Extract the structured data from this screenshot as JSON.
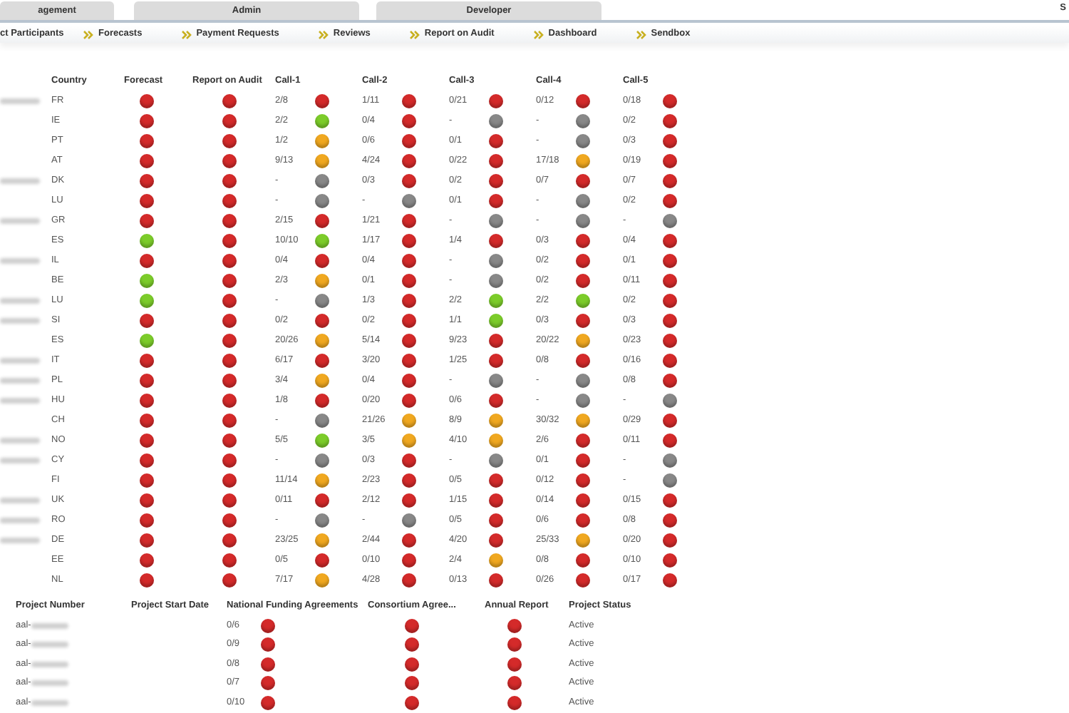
{
  "top_tabs": [
    {
      "label": "agement",
      "selected": false
    },
    {
      "label": "Admin",
      "selected": false
    },
    {
      "label": "Developer",
      "selected": false
    }
  ],
  "top_right": "S",
  "nav": [
    "ct Participants",
    "Forecasts",
    "Payment Requests",
    "Reviews",
    "Report on Audit",
    "Dashboard",
    "Sendbox"
  ],
  "calls_table": {
    "columns": [
      "Country",
      "Forecast",
      "Report on Audit",
      "Call-1",
      "Call-2",
      "Call-3",
      "Call-4",
      "Call-5"
    ],
    "rows": [
      {
        "redacted": true,
        "country": "FR",
        "forecast": {
          "color": "#d42a2a"
        },
        "report": {
          "color": "#d42a2a"
        },
        "calls": [
          {
            "value": "2/8",
            "color": "#d42a2a"
          },
          {
            "value": "1/11",
            "color": "#d42a2a"
          },
          {
            "value": "0/21",
            "color": "#d42a2a"
          },
          {
            "value": "0/12",
            "color": "#d42a2a"
          },
          {
            "value": "0/18",
            "color": "#d42a2a"
          }
        ]
      },
      {
        "redacted": false,
        "country": "IE",
        "forecast": {
          "color": "#d42a2a"
        },
        "report": {
          "color": "#d42a2a"
        },
        "calls": [
          {
            "value": "2/2",
            "color": "#7ccc2a"
          },
          {
            "value": "0/4",
            "color": "#d42a2a"
          },
          {
            "value": "-",
            "color": "#888888"
          },
          {
            "value": "-",
            "color": "#888888"
          },
          {
            "value": "0/2",
            "color": "#d42a2a"
          }
        ]
      },
      {
        "redacted": false,
        "country": "PT",
        "forecast": {
          "color": "#d42a2a"
        },
        "report": {
          "color": "#d42a2a"
        },
        "calls": [
          {
            "value": "1/2",
            "color": "#f0a820"
          },
          {
            "value": "0/6",
            "color": "#d42a2a"
          },
          {
            "value": "0/1",
            "color": "#d42a2a"
          },
          {
            "value": "-",
            "color": "#888888"
          },
          {
            "value": "0/3",
            "color": "#d42a2a"
          }
        ]
      },
      {
        "redacted": false,
        "country": "AT",
        "forecast": {
          "color": "#d42a2a"
        },
        "report": {
          "color": "#d42a2a"
        },
        "calls": [
          {
            "value": "9/13",
            "color": "#f0a820"
          },
          {
            "value": "4/24",
            "color": "#d42a2a"
          },
          {
            "value": "0/22",
            "color": "#d42a2a"
          },
          {
            "value": "17/18",
            "color": "#f0a820"
          },
          {
            "value": "0/19",
            "color": "#d42a2a"
          }
        ]
      },
      {
        "redacted": true,
        "country": "DK",
        "forecast": {
          "color": "#d42a2a"
        },
        "report": {
          "color": "#d42a2a"
        },
        "calls": [
          {
            "value": "-",
            "color": "#888888"
          },
          {
            "value": "0/3",
            "color": "#d42a2a"
          },
          {
            "value": "0/2",
            "color": "#d42a2a"
          },
          {
            "value": "0/7",
            "color": "#d42a2a"
          },
          {
            "value": "0/7",
            "color": "#d42a2a"
          }
        ]
      },
      {
        "redacted": false,
        "country": "LU",
        "forecast": {
          "color": "#d42a2a"
        },
        "report": {
          "color": "#d42a2a"
        },
        "calls": [
          {
            "value": "-",
            "color": "#888888"
          },
          {
            "value": "-",
            "color": "#888888"
          },
          {
            "value": "0/1",
            "color": "#d42a2a"
          },
          {
            "value": "-",
            "color": "#888888"
          },
          {
            "value": "0/2",
            "color": "#d42a2a"
          }
        ]
      },
      {
        "redacted": true,
        "country": "GR",
        "forecast": {
          "color": "#d42a2a"
        },
        "report": {
          "color": "#d42a2a"
        },
        "calls": [
          {
            "value": "2/15",
            "color": "#d42a2a"
          },
          {
            "value": "1/21",
            "color": "#d42a2a"
          },
          {
            "value": "-",
            "color": "#888888"
          },
          {
            "value": "-",
            "color": "#888888"
          },
          {
            "value": "-",
            "color": "#888888"
          }
        ]
      },
      {
        "redacted": false,
        "country": "ES",
        "forecast": {
          "color": "#7ccc2a"
        },
        "report": {
          "color": "#d42a2a"
        },
        "calls": [
          {
            "value": "10/10",
            "color": "#7ccc2a"
          },
          {
            "value": "1/17",
            "color": "#d42a2a"
          },
          {
            "value": "1/4",
            "color": "#d42a2a"
          },
          {
            "value": "0/3",
            "color": "#d42a2a"
          },
          {
            "value": "0/4",
            "color": "#d42a2a"
          }
        ]
      },
      {
        "redacted": true,
        "country": "IL",
        "forecast": {
          "color": "#d42a2a"
        },
        "report": {
          "color": "#d42a2a"
        },
        "calls": [
          {
            "value": "0/4",
            "color": "#d42a2a"
          },
          {
            "value": "0/4",
            "color": "#d42a2a"
          },
          {
            "value": "-",
            "color": "#888888"
          },
          {
            "value": "0/2",
            "color": "#d42a2a"
          },
          {
            "value": "0/1",
            "color": "#d42a2a"
          }
        ]
      },
      {
        "redacted": false,
        "country": "BE",
        "forecast": {
          "color": "#7ccc2a"
        },
        "report": {
          "color": "#d42a2a"
        },
        "calls": [
          {
            "value": "2/3",
            "color": "#f0a820"
          },
          {
            "value": "0/1",
            "color": "#d42a2a"
          },
          {
            "value": "-",
            "color": "#888888"
          },
          {
            "value": "0/2",
            "color": "#d42a2a"
          },
          {
            "value": "0/11",
            "color": "#d42a2a"
          }
        ]
      },
      {
        "redacted": true,
        "country": "LU",
        "forecast": {
          "color": "#7ccc2a"
        },
        "report": {
          "color": "#d42a2a"
        },
        "calls": [
          {
            "value": "-",
            "color": "#888888"
          },
          {
            "value": "1/3",
            "color": "#d42a2a"
          },
          {
            "value": "2/2",
            "color": "#7ccc2a"
          },
          {
            "value": "2/2",
            "color": "#7ccc2a"
          },
          {
            "value": "0/2",
            "color": "#d42a2a"
          }
        ]
      },
      {
        "redacted": true,
        "country": "SI",
        "forecast": {
          "color": "#d42a2a"
        },
        "report": {
          "color": "#d42a2a"
        },
        "calls": [
          {
            "value": "0/2",
            "color": "#d42a2a"
          },
          {
            "value": "0/2",
            "color": "#d42a2a"
          },
          {
            "value": "1/1",
            "color": "#7ccc2a"
          },
          {
            "value": "0/3",
            "color": "#d42a2a"
          },
          {
            "value": "0/3",
            "color": "#d42a2a"
          }
        ]
      },
      {
        "redacted": false,
        "country": "ES",
        "forecast": {
          "color": "#7ccc2a"
        },
        "report": {
          "color": "#d42a2a"
        },
        "calls": [
          {
            "value": "20/26",
            "color": "#f0a820"
          },
          {
            "value": "5/14",
            "color": "#d42a2a"
          },
          {
            "value": "9/23",
            "color": "#d42a2a"
          },
          {
            "value": "20/22",
            "color": "#f0a820"
          },
          {
            "value": "0/23",
            "color": "#d42a2a"
          }
        ]
      },
      {
        "redacted": true,
        "country": "IT",
        "forecast": {
          "color": "#d42a2a"
        },
        "report": {
          "color": "#d42a2a"
        },
        "calls": [
          {
            "value": "6/17",
            "color": "#d42a2a"
          },
          {
            "value": "3/20",
            "color": "#d42a2a"
          },
          {
            "value": "1/25",
            "color": "#d42a2a"
          },
          {
            "value": "0/8",
            "color": "#d42a2a"
          },
          {
            "value": "0/16",
            "color": "#d42a2a"
          }
        ]
      },
      {
        "redacted": true,
        "country": "PL",
        "forecast": {
          "color": "#d42a2a"
        },
        "report": {
          "color": "#d42a2a"
        },
        "calls": [
          {
            "value": "3/4",
            "color": "#f0a820"
          },
          {
            "value": "0/4",
            "color": "#d42a2a"
          },
          {
            "value": "-",
            "color": "#888888"
          },
          {
            "value": "-",
            "color": "#888888"
          },
          {
            "value": "0/8",
            "color": "#d42a2a"
          }
        ]
      },
      {
        "redacted": true,
        "country": "HU",
        "forecast": {
          "color": "#d42a2a"
        },
        "report": {
          "color": "#d42a2a"
        },
        "calls": [
          {
            "value": "1/8",
            "color": "#d42a2a"
          },
          {
            "value": "0/20",
            "color": "#d42a2a"
          },
          {
            "value": "0/6",
            "color": "#d42a2a"
          },
          {
            "value": "-",
            "color": "#888888"
          },
          {
            "value": "-",
            "color": "#888888"
          }
        ]
      },
      {
        "redacted": false,
        "country": "CH",
        "forecast": {
          "color": "#d42a2a"
        },
        "report": {
          "color": "#d42a2a"
        },
        "calls": [
          {
            "value": "-",
            "color": "#888888"
          },
          {
            "value": "21/26",
            "color": "#f0a820"
          },
          {
            "value": "8/9",
            "color": "#f0a820"
          },
          {
            "value": "30/32",
            "color": "#f0a820"
          },
          {
            "value": "0/29",
            "color": "#d42a2a"
          }
        ]
      },
      {
        "redacted": true,
        "country": "NO",
        "forecast": {
          "color": "#d42a2a"
        },
        "report": {
          "color": "#d42a2a"
        },
        "calls": [
          {
            "value": "5/5",
            "color": "#7ccc2a"
          },
          {
            "value": "3/5",
            "color": "#f0a820"
          },
          {
            "value": "4/10",
            "color": "#f0a820"
          },
          {
            "value": "2/6",
            "color": "#d42a2a"
          },
          {
            "value": "0/11",
            "color": "#d42a2a"
          }
        ]
      },
      {
        "redacted": true,
        "country": "CY",
        "forecast": {
          "color": "#d42a2a"
        },
        "report": {
          "color": "#d42a2a"
        },
        "calls": [
          {
            "value": "-",
            "color": "#888888"
          },
          {
            "value": "0/3",
            "color": "#d42a2a"
          },
          {
            "value": "-",
            "color": "#888888"
          },
          {
            "value": "0/1",
            "color": "#d42a2a"
          },
          {
            "value": "-",
            "color": "#888888"
          }
        ]
      },
      {
        "redacted": false,
        "country": "FI",
        "forecast": {
          "color": "#d42a2a"
        },
        "report": {
          "color": "#d42a2a"
        },
        "calls": [
          {
            "value": "11/14",
            "color": "#f0a820"
          },
          {
            "value": "2/23",
            "color": "#d42a2a"
          },
          {
            "value": "0/5",
            "color": "#d42a2a"
          },
          {
            "value": "0/12",
            "color": "#d42a2a"
          },
          {
            "value": "-",
            "color": "#888888"
          }
        ]
      },
      {
        "redacted": true,
        "country": "UK",
        "forecast": {
          "color": "#d42a2a"
        },
        "report": {
          "color": "#d42a2a"
        },
        "calls": [
          {
            "value": "0/11",
            "color": "#d42a2a"
          },
          {
            "value": "2/12",
            "color": "#d42a2a"
          },
          {
            "value": "1/15",
            "color": "#d42a2a"
          },
          {
            "value": "0/14",
            "color": "#d42a2a"
          },
          {
            "value": "0/15",
            "color": "#d42a2a"
          }
        ]
      },
      {
        "redacted": true,
        "country": "RO",
        "forecast": {
          "color": "#d42a2a"
        },
        "report": {
          "color": "#d42a2a"
        },
        "calls": [
          {
            "value": "-",
            "color": "#888888"
          },
          {
            "value": "-",
            "color": "#888888"
          },
          {
            "value": "0/5",
            "color": "#d42a2a"
          },
          {
            "value": "0/6",
            "color": "#d42a2a"
          },
          {
            "value": "0/8",
            "color": "#d42a2a"
          }
        ]
      },
      {
        "redacted": true,
        "country": "DE",
        "forecast": {
          "color": "#d42a2a"
        },
        "report": {
          "color": "#d42a2a"
        },
        "calls": [
          {
            "value": "23/25",
            "color": "#f0a820"
          },
          {
            "value": "2/44",
            "color": "#d42a2a"
          },
          {
            "value": "4/20",
            "color": "#d42a2a"
          },
          {
            "value": "25/33",
            "color": "#f0a820"
          },
          {
            "value": "0/20",
            "color": "#d42a2a"
          }
        ]
      },
      {
        "redacted": false,
        "country": "EE",
        "forecast": {
          "color": "#d42a2a"
        },
        "report": {
          "color": "#d42a2a"
        },
        "calls": [
          {
            "value": "0/5",
            "color": "#d42a2a"
          },
          {
            "value": "0/10",
            "color": "#d42a2a"
          },
          {
            "value": "2/4",
            "color": "#f0a820"
          },
          {
            "value": "0/8",
            "color": "#d42a2a"
          },
          {
            "value": "0/10",
            "color": "#d42a2a"
          }
        ]
      },
      {
        "redacted": false,
        "country": "NL",
        "forecast": {
          "color": "#d42a2a"
        },
        "report": {
          "color": "#d42a2a"
        },
        "calls": [
          {
            "value": "7/17",
            "color": "#f0a820"
          },
          {
            "value": "4/28",
            "color": "#d42a2a"
          },
          {
            "value": "0/13",
            "color": "#d42a2a"
          },
          {
            "value": "0/26",
            "color": "#d42a2a"
          },
          {
            "value": "0/17",
            "color": "#d42a2a"
          }
        ]
      }
    ]
  },
  "projects_table": {
    "columns": [
      "Project Number",
      "Project Start Date",
      "National Funding Agreements",
      "Consortium Agree...",
      "Annual Report",
      "Project Status"
    ],
    "rows": [
      {
        "number": "aal-",
        "funding": {
          "value": "0/6",
          "color": "#d42a2a"
        },
        "consortium": {
          "color": "#d42a2a"
        },
        "annual": {
          "color": "#d42a2a"
        },
        "status": "Active"
      },
      {
        "number": "aal-",
        "funding": {
          "value": "0/9",
          "color": "#d42a2a"
        },
        "consortium": {
          "color": "#d42a2a"
        },
        "annual": {
          "color": "#d42a2a"
        },
        "status": "Active"
      },
      {
        "number": "aal-",
        "funding": {
          "value": "0/8",
          "color": "#d42a2a"
        },
        "consortium": {
          "color": "#d42a2a"
        },
        "annual": {
          "color": "#d42a2a"
        },
        "status": "Active"
      },
      {
        "number": "aal-",
        "funding": {
          "value": "0/7",
          "color": "#d42a2a"
        },
        "consortium": {
          "color": "#d42a2a"
        },
        "annual": {
          "color": "#d42a2a"
        },
        "status": "Active"
      },
      {
        "number": "aal-",
        "funding": {
          "value": "0/10",
          "color": "#d42a2a"
        },
        "consortium": {
          "color": "#d42a2a"
        },
        "annual": {
          "color": "#d42a2a"
        },
        "status": "Active"
      }
    ]
  }
}
